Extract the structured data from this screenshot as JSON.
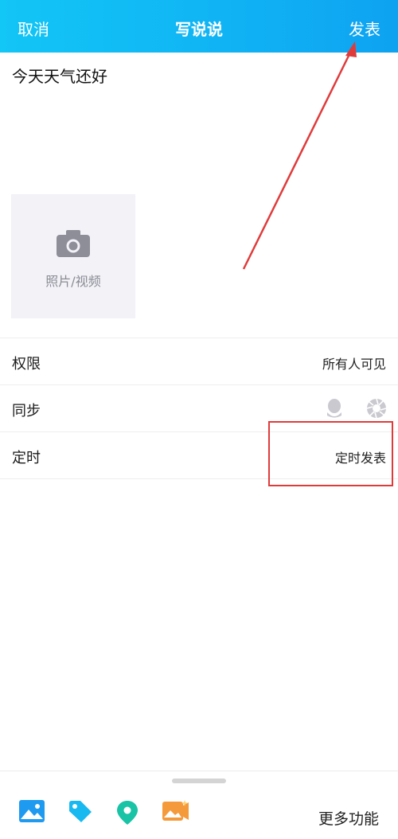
{
  "header": {
    "cancel_label": "取消",
    "title": "写说说",
    "publish_label": "发表"
  },
  "post": {
    "content": "今天天气还好"
  },
  "media": {
    "label": "照片/视频",
    "icon": "camera-icon"
  },
  "settings": [
    {
      "label": "权限",
      "value": "所有人可见"
    },
    {
      "label": "同步",
      "icons": [
        "qq-penguin-icon",
        "shutter-icon"
      ]
    },
    {
      "label": "定时",
      "value": "定时发表"
    }
  ],
  "toolbar": {
    "icons": [
      "image-icon",
      "tag-icon",
      "location-icon",
      "photo-video-icon"
    ],
    "more_label": "更多功能"
  },
  "colors": {
    "header": "#12c6f6",
    "annotation": "#e03b3b",
    "tag": "#18b8f0",
    "location": "#19c3a6",
    "photo_video": "#f59a3a"
  }
}
